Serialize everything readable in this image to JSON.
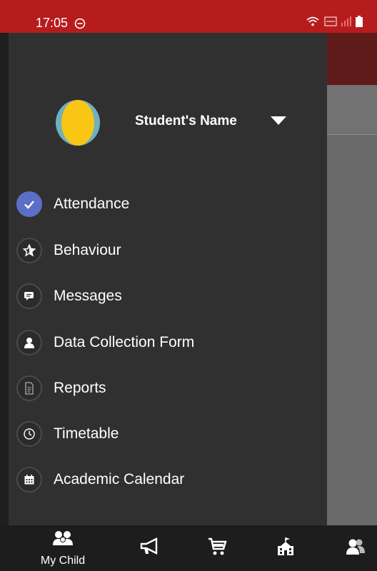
{
  "status_bar": {
    "time": "17:05",
    "icons": [
      "do-not-disturb-icon",
      "wifi-icon",
      "volte-icon",
      "signal-icon",
      "battery-icon"
    ],
    "volte_text": "Vo))\nLTE1"
  },
  "drawer": {
    "student_name": "Student's Name",
    "menu": [
      {
        "label": "Attendance",
        "icon": "check-icon",
        "active": true
      },
      {
        "label": "Behaviour",
        "icon": "star-icon",
        "active": false
      },
      {
        "label": "Messages",
        "icon": "chat-icon",
        "active": false
      },
      {
        "label": "Data Collection Form",
        "icon": "person-icon",
        "active": false
      },
      {
        "label": "Reports",
        "icon": "document-icon",
        "active": false
      },
      {
        "label": "Timetable",
        "icon": "clock-icon",
        "active": false
      },
      {
        "label": "Academic Calendar",
        "icon": "calendar-icon",
        "active": false
      }
    ]
  },
  "bottom_nav": {
    "items": [
      {
        "label": "My Child",
        "icon": "children-icon"
      },
      {
        "label": "",
        "icon": "megaphone-icon"
      },
      {
        "label": "",
        "icon": "cart-icon"
      },
      {
        "label": "",
        "icon": "school-icon"
      },
      {
        "label": "",
        "icon": "people-icon"
      }
    ]
  },
  "colors": {
    "status_bar": "#b71c1c",
    "drawer": "#303030",
    "active_icon": "#5b6fc7",
    "bottom_nav": "#1d1d1d"
  }
}
